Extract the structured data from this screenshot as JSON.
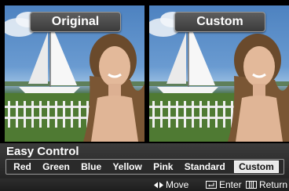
{
  "panels": {
    "left": {
      "title": "Original"
    },
    "right": {
      "title": "Custom"
    }
  },
  "easy_control": {
    "title": "Easy Control",
    "options": [
      "Red",
      "Green",
      "Blue",
      "Yellow",
      "Pink",
      "Standard",
      "Custom"
    ],
    "selected": "Custom"
  },
  "help": {
    "move": "Move",
    "enter": "Enter",
    "return": "Return"
  },
  "icons": {
    "move": "left-right-arrows-icon",
    "enter": "enter-icon",
    "return": "return-icon"
  }
}
